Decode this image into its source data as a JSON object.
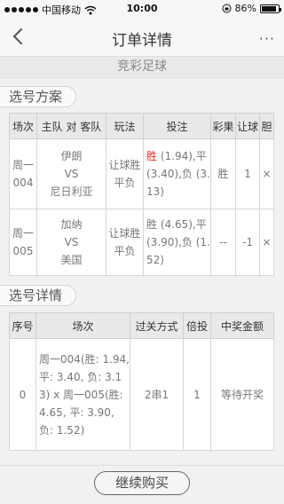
{
  "status": {
    "carrier": "中国移动",
    "time": "10:00",
    "battery": "86%"
  },
  "nav": {
    "title": "订单详情",
    "more": "···"
  },
  "subtitle": "竞彩足球",
  "plan": {
    "heading": "选号方案",
    "headers": [
      "场次",
      "主队 对 客队",
      "玩法",
      "投注",
      "彩果",
      "让球",
      "胆"
    ],
    "rows": [
      {
        "match": "周一004",
        "home": "伊朗",
        "vs": "VS",
        "away": "尼日利亚",
        "play": "让球胜平负",
        "bet_hit": "胜",
        "bet_rest": " (1.94),平(3.40),负 (3.13)",
        "result": "胜",
        "handicap": "1",
        "banker": "×"
      },
      {
        "match": "周一005",
        "home": "加纳",
        "vs": "VS",
        "away": "美国",
        "play": "让球胜平负",
        "bet_hit": "",
        "bet_rest": "胜 (4.65),平(3.90),负 (1.52)",
        "result": "--",
        "handicap": "-1",
        "banker": "×"
      }
    ]
  },
  "detail": {
    "heading": "选号详情",
    "headers": [
      "序号",
      "场次",
      "过关方式",
      "倍投",
      "中奖金额"
    ],
    "rows": [
      {
        "index": "0",
        "matches": "周一004(胜: 1.94, 平: 3.40, 负: 3.13) x 周一005(胜: 4.65, 平: 3.90, 负: 1.52)",
        "pass": "2串1",
        "multiple": "1",
        "prize": "等待开奖"
      }
    ]
  },
  "actions": {
    "continue_label": "继续购买"
  }
}
